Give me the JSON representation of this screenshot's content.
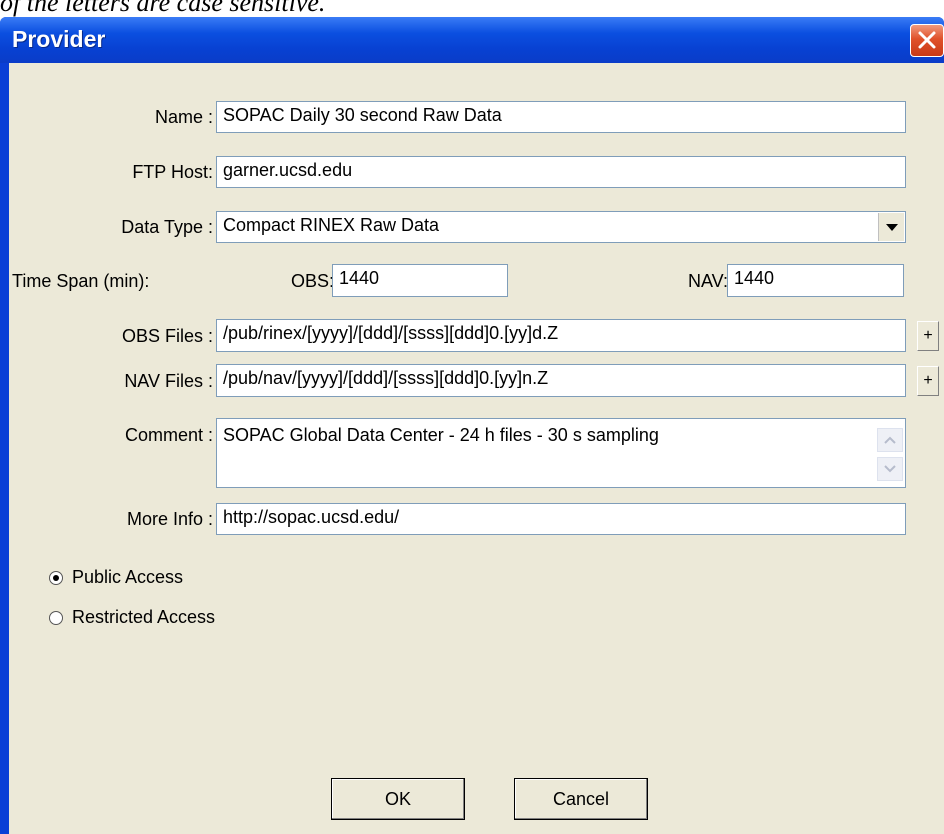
{
  "top_text": "of the letters are case sensitive.",
  "window": {
    "title": "Provider"
  },
  "form": {
    "name_label": "Name :",
    "name_value": "SOPAC Daily 30 second Raw Data",
    "ftp_label": "FTP Host:",
    "ftp_value": "garner.ucsd.edu",
    "datatype_label": "Data Type :",
    "datatype_value": "Compact RINEX Raw Data",
    "timespan_label": "Time Span (min):",
    "obs_label": "OBS:",
    "obs_value": "1440",
    "nav_label": "NAV:",
    "nav_value": "1440",
    "obsfiles_label": "OBS Files :",
    "obsfiles_value": "/pub/rinex/[yyyy]/[ddd]/[ssss][ddd]0.[yy]d.Z",
    "navfiles_label": "NAV Files :",
    "navfiles_value": "/pub/nav/[yyyy]/[ddd]/[ssss][ddd]0.[yy]n.Z",
    "comment_label": "Comment :",
    "comment_value": "SOPAC Global Data Center - 24 h files - 30 s sampling",
    "moreinfo_label": "More Info :",
    "moreinfo_value": "http://sopac.ucsd.edu/",
    "plus_label": "+"
  },
  "access": {
    "public_label": "Public Access",
    "restricted_label": "Restricted Access",
    "selected": "public"
  },
  "buttons": {
    "ok": "OK",
    "cancel": "Cancel"
  },
  "icons": {
    "close": "close-icon",
    "dropdown": "chevron-down-icon",
    "scroll_up": "scroll-up-icon",
    "scroll_down": "scroll-down-icon"
  }
}
